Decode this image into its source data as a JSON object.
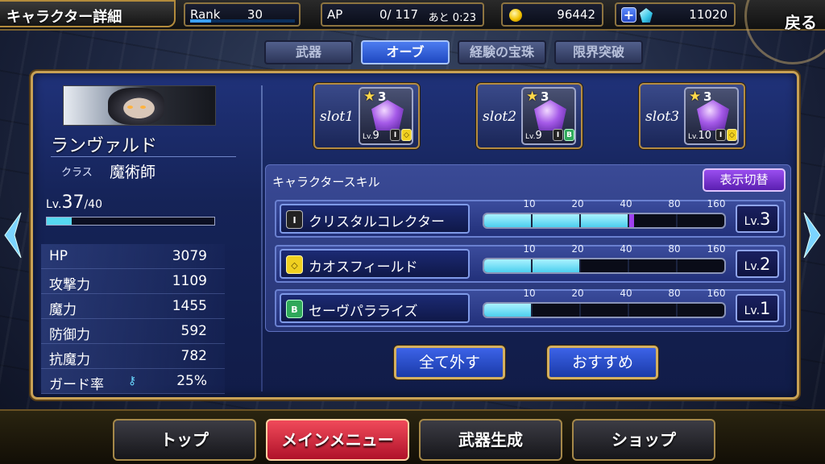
{
  "header": {
    "title": "キャラクター詳細",
    "rank_label": "Rank",
    "rank_value": "30",
    "rank_progress": 0.2,
    "ap_label": "AP",
    "ap_value": "0/ 117",
    "ap_timer": "あと 0:23",
    "gil": "96442",
    "gems": "11020",
    "back_label": "戻る"
  },
  "tabs": [
    {
      "label": "武器",
      "active": false
    },
    {
      "label": "オーブ",
      "active": true
    },
    {
      "label": "経験の宝珠",
      "active": false
    },
    {
      "label": "限界突破",
      "active": false
    }
  ],
  "character": {
    "name": "ランヴァルド",
    "class_label": "クラス",
    "class_value": "魔術師",
    "lv_prefix": "Lv.",
    "lv_current": "37",
    "lv_max": "/40",
    "exp_progress": 0.15,
    "stats": [
      {
        "key": "HP",
        "value": "3079"
      },
      {
        "key": "攻撃力",
        "value": "1109"
      },
      {
        "key": "魔力",
        "value": "1455"
      },
      {
        "key": "防御力",
        "value": "592"
      },
      {
        "key": "抗魔力",
        "value": "782"
      },
      {
        "key": "ガード率",
        "value": "25%"
      }
    ]
  },
  "slots": [
    {
      "label": "slot1",
      "stars": "3",
      "level": "9",
      "icons": [
        "I",
        "◇"
      ]
    },
    {
      "label": "slot2",
      "stars": "3",
      "level": "9",
      "icons": [
        "I",
        "B"
      ]
    },
    {
      "label": "slot3",
      "stars": "3",
      "level": "10",
      "icons": [
        "I",
        "◇"
      ]
    }
  ],
  "skills_panel": {
    "heading": "キャラクタースキル",
    "toggle_label": "表示切替",
    "tick_labels": [
      "10",
      "20",
      "40",
      "80",
      "160"
    ],
    "skills": [
      {
        "name": "クリスタルコレクター",
        "icon": "I",
        "level": "3",
        "fill": 0.6
      },
      {
        "name": "カオスフィールド",
        "icon": "◇",
        "level": "2",
        "fill": 0.4
      },
      {
        "name": "セーヴパラライズ",
        "icon": "B",
        "level": "1",
        "fill": 0.2
      }
    ]
  },
  "actions": {
    "unequip_all": "全て外す",
    "recommend": "おすすめ"
  },
  "nav": [
    {
      "label": "トップ",
      "active": false
    },
    {
      "label": "メインメニュー",
      "active": true
    },
    {
      "label": "武器生成",
      "active": false
    },
    {
      "label": "ショップ",
      "active": false
    }
  ]
}
